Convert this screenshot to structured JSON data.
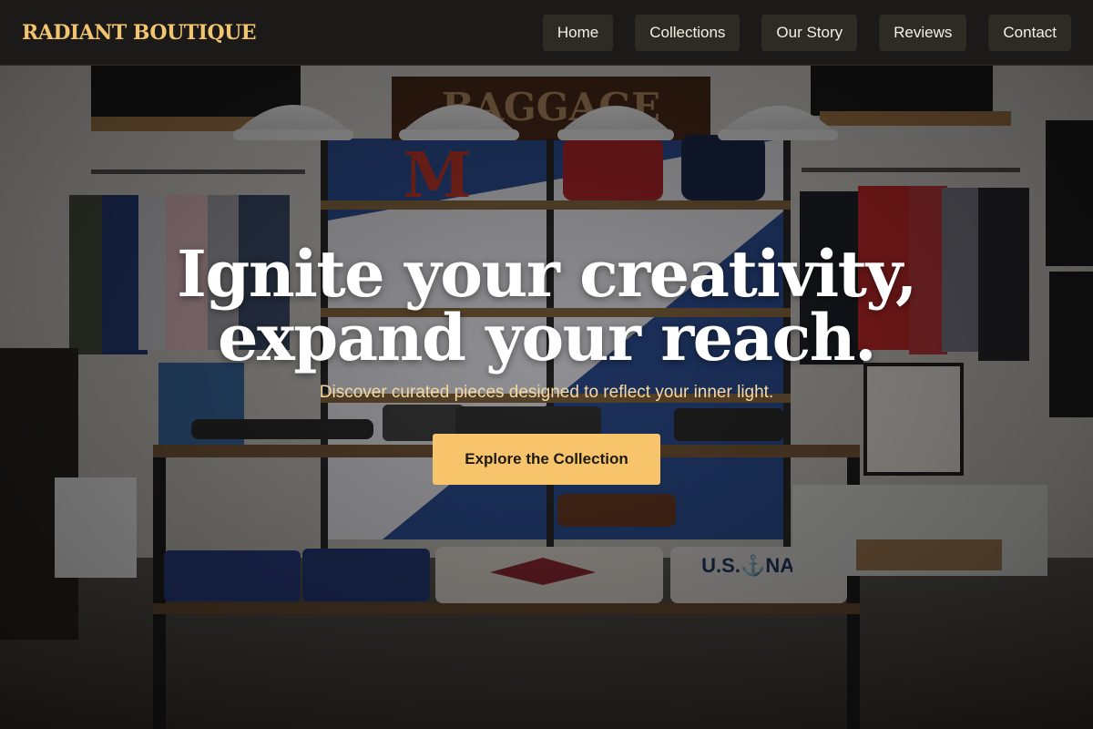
{
  "header": {
    "brand": "RADIANT BOUTIQUE",
    "nav": [
      "Home",
      "Collections",
      "Our Story",
      "Reviews",
      "Contact"
    ]
  },
  "hero": {
    "headline_line1": "Ignite your creativity,",
    "headline_line2": "expand your reach.",
    "subhead": "Discover curated pieces designed to reflect your inner light.",
    "cta_label": "Explore the Collection"
  },
  "colors": {
    "brand": "#f2c46f",
    "cta_bg": "#f7c46b",
    "nav_bg": "#2e2b25",
    "header_bg": "#1b1a19",
    "subhead": "#f6d9a0"
  }
}
